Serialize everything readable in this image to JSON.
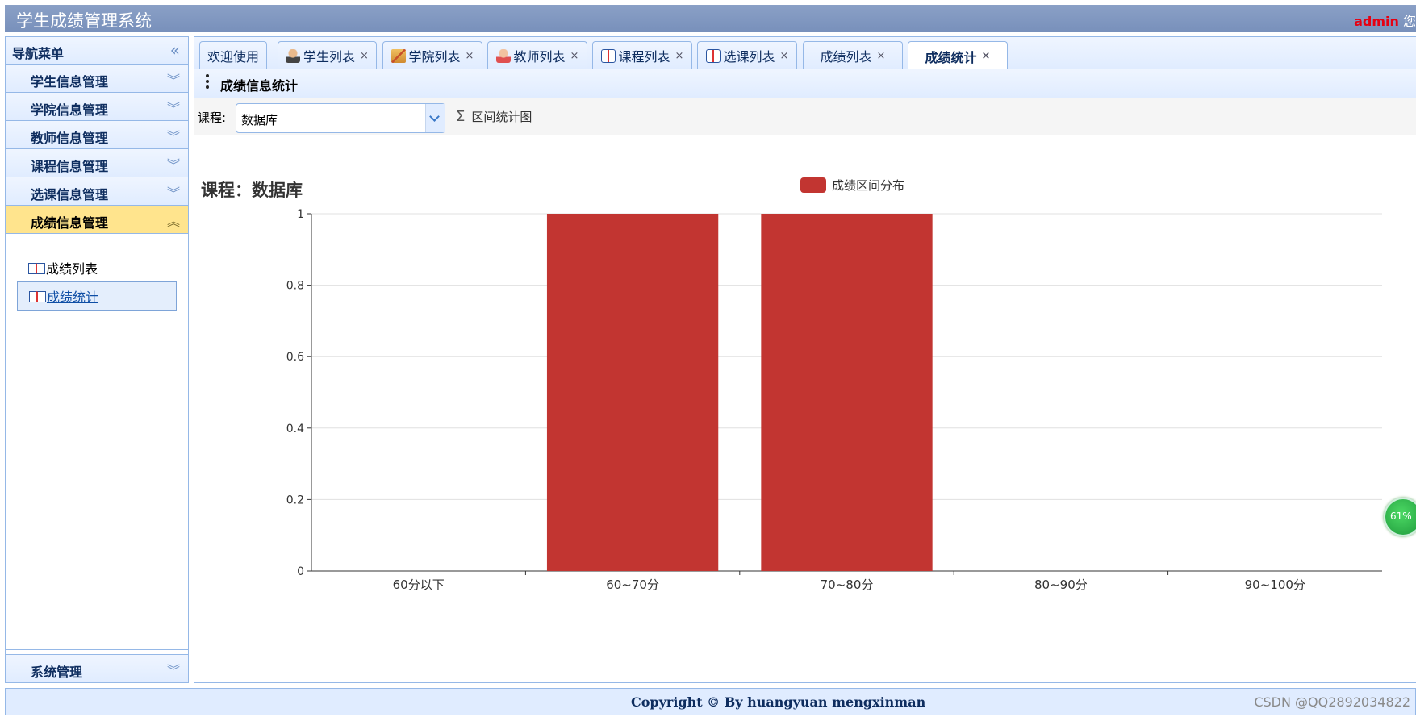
{
  "app": {
    "title": "学生成绩管理系统",
    "user_name": "admin",
    "user_suffix": "您"
  },
  "sidebar": {
    "header": "导航菜单",
    "collapse_icon": "double-chevron-left-icon",
    "sections": [
      {
        "label": "学生信息管理"
      },
      {
        "label": "学院信息管理"
      },
      {
        "label": "教师信息管理"
      },
      {
        "label": "课程信息管理"
      },
      {
        "label": "选课信息管理"
      },
      {
        "label": "成绩信息管理",
        "active": true
      }
    ],
    "sub_items": [
      {
        "label": "成绩列表",
        "icon": "book-icon"
      },
      {
        "label": "成绩统计",
        "icon": "book-icon",
        "selected": true
      }
    ],
    "bottom_section": "系统管理"
  },
  "tabs": [
    {
      "label": "欢迎使用",
      "closable": false
    },
    {
      "label": "学生列表",
      "icon": "person-icon",
      "closable": true
    },
    {
      "label": "学院列表",
      "icon": "house-icon",
      "closable": true
    },
    {
      "label": "教师列表",
      "icon": "woman-icon",
      "closable": true
    },
    {
      "label": "课程列表",
      "icon": "book-icon",
      "closable": true
    },
    {
      "label": "选课列表",
      "icon": "book-icon",
      "closable": true
    },
    {
      "label": "成绩列表",
      "closable": true
    },
    {
      "label": "成绩统计",
      "closable": true,
      "active": true
    }
  ],
  "close_glyph": "×",
  "panel": {
    "title": "成绩信息统计",
    "course_label": "课程:",
    "course_value": "数据库",
    "stat_button": "区间统计图",
    "stat_icon": "sigma-icon"
  },
  "chart_data": {
    "type": "bar",
    "title": "课程：数据库",
    "legend": [
      "成绩区间分布"
    ],
    "legend_position": "top-center",
    "categories": [
      "60分以下",
      "60~70分",
      "70~80分",
      "80~90分",
      "90~100分"
    ],
    "series": [
      {
        "name": "成绩区间分布",
        "values": [
          0,
          1,
          1,
          0,
          0
        ]
      }
    ],
    "ylim": [
      0,
      1
    ],
    "yticks": [
      "0",
      "0.2",
      "0.4",
      "0.6",
      "0.8",
      "1"
    ],
    "grid": true,
    "color": "#c23531"
  },
  "progress_badge": "61%",
  "footer": {
    "copyright": "Copyright © By huangyuan mengxinman",
    "watermark": "CSDN @QQ2892034822"
  },
  "colors": {
    "header": "#7d96c0",
    "accent_border": "#95b8e7",
    "active_section": "#ffe48d",
    "user_name": "#e60012"
  }
}
